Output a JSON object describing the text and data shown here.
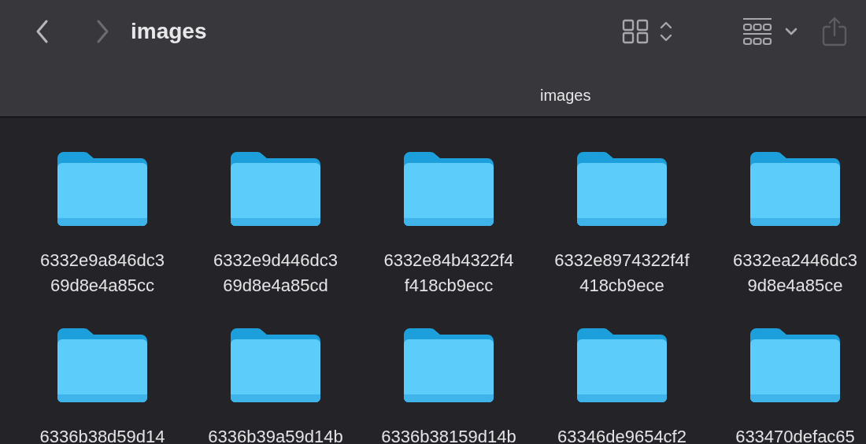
{
  "window": {
    "title": "images"
  },
  "navigation": [
    {
      "kind": "back",
      "disabled": false
    },
    {
      "kind": "forward",
      "disabled": true
    }
  ],
  "toolbar": [
    {
      "kind": "icon-view"
    },
    {
      "kind": "group"
    },
    {
      "kind": "share",
      "disabled": true
    }
  ],
  "path_bar": {
    "label": "images"
  },
  "items": [
    {
      "label_lines": [
        "6332e9a846dc3",
        "69d8e4a85cc"
      ]
    },
    {
      "label_lines": [
        "6332e9d446dc3",
        "69d8e4a85cd"
      ]
    },
    {
      "label_lines": [
        "6332e84b4322f4",
        "f418cb9ecc"
      ]
    },
    {
      "label_lines": [
        "6332e8974322f4f",
        "418cb9ece"
      ]
    },
    {
      "label_lines": [
        "6332ea2446dc3",
        "9d8e4a85ce"
      ]
    },
    {
      "label_lines": [
        "6336b38d59d14"
      ]
    },
    {
      "label_lines": [
        "6336b39a59d14b"
      ]
    },
    {
      "label_lines": [
        "6336b38159d14b"
      ]
    },
    {
      "label_lines": [
        "63346de9654cf2"
      ]
    },
    {
      "label_lines": [
        "633470defac65"
      ]
    }
  ]
}
